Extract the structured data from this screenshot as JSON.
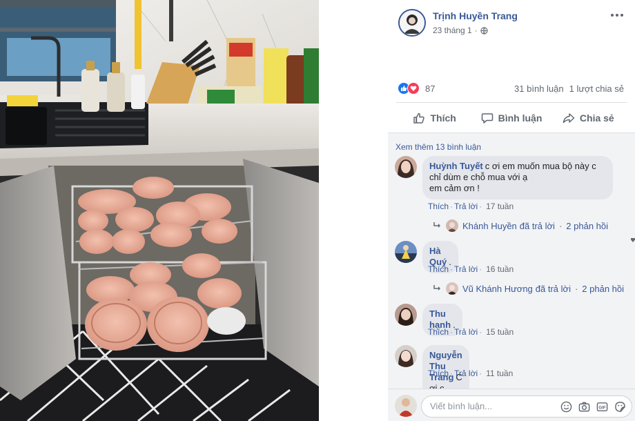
{
  "post": {
    "author": "Trịnh Huyền Trang",
    "date": "23 tháng 1",
    "reaction_count": "87",
    "comment_count": "31 bình luận",
    "share_count": "1 lượt chia sẻ"
  },
  "actions": {
    "like": "Thích",
    "comment": "Bình luận",
    "share": "Chia sẻ"
  },
  "comments": {
    "see_more": "Xem thêm 13 bình luận",
    "items": [
      {
        "author": "Huỳnh Tuyết",
        "line1": "c ơi em muốn mua bộ này c",
        "line2": "chỉ dùm e chỗ mua với ạ",
        "line3": "em cảm ơn !",
        "like": "Thích",
        "reply": "Trả lời",
        "time": "17 tuần",
        "reply_summary": {
          "name": "Khánh Huyền",
          "text": "đã trả lời",
          "count": "2 phản hồi"
        }
      },
      {
        "author": "Hà Quý",
        "text": ".",
        "like": "Thích",
        "reply": "Trả lời",
        "time": "16 tuần",
        "reply_summary": {
          "name": "Vũ Khánh Hương",
          "text": "đã trả lời",
          "count": "2 phản hồi"
        }
      },
      {
        "author": "Thu hạnh",
        "text": ".",
        "like": "Thích",
        "reply": "Trả lời",
        "time": "15 tuần"
      },
      {
        "author": "Nguyễn Thu Trang",
        "text": "C ơi c mua ở đâu vậy ạ",
        "like": "Thích",
        "reply": "Trả lời",
        "time": "11 tuần"
      }
    ]
  },
  "composer": {
    "placeholder": "Viết bình luận..."
  },
  "colors": {
    "link": "#385898",
    "like_blue": "#1877f2",
    "love_red": "#f33e58",
    "bubble": "#e4e6eb"
  },
  "icons": [
    "globe-icon",
    "like-icon",
    "comment-icon",
    "share-icon",
    "emoji-icon",
    "camera-icon",
    "gif-icon",
    "sticker-icon",
    "reply-arrow-icon",
    "more-icon"
  ]
}
